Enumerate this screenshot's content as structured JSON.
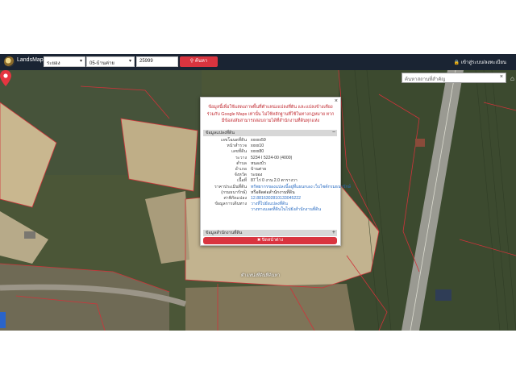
{
  "topbar": {
    "app_title": "LandsMaps",
    "province_select": "ระยอง",
    "district_select": "05-บ้านค่าย",
    "parcel_input": "25999",
    "search_button": "ค้นหา",
    "user_link": "เข้าสู่ระบบ/ลงทะเบียน"
  },
  "map": {
    "search_placeholder": "ค้นหาสถานที่สำคัญ",
    "pin_label": "ตำแหน่งที่ดินที่ค้นหา"
  },
  "popup": {
    "warning": "ข้อมูลนี้เพื่อใช้แสดงภาพพื้นที่ตำแหน่งแปลงที่ดิน และแปลงข้างเคียงร่วมกับ Google Maps เท่านั้น ไม่ใช้หลักฐานที่ใช้ในทางกฎหมาย หากมีข้อสงสัยสามารถสอบถามได้ที่สำนักงานที่ดินทุกแห่ง",
    "section_land": "ข้อมูลแปลงที่ดิน",
    "section_land_toggle": "−",
    "rows": [
      {
        "label": "เลขโฉนดที่ดิน",
        "value": "xxxxx59"
      },
      {
        "label": "หน้าสำรวจ",
        "value": "xxxx10"
      },
      {
        "label": "เลขที่ดิน",
        "value": "xxxx80"
      },
      {
        "label": "ระวาง",
        "value": "5234 I 5224-00 (4000)"
      },
      {
        "label": "ตำบล",
        "value": "หนองบัว"
      },
      {
        "label": "อำเภอ",
        "value": "บ้านค่าย"
      },
      {
        "label": "จังหวัด",
        "value": "ระยอง"
      },
      {
        "label": "เนื้อที่",
        "value": "87 ไร่ 0 งาน 2.0 ตารางวา"
      },
      {
        "label": "ราคาประเมินที่ดิน",
        "value": "ทรัพยากรของแปลงนี้อยู่ที่แผนกเอง เว็บไซต์กรมธนารักษ์"
      },
      {
        "label": "(กรมธนารักษ์)",
        "value": "หรือติดต่อสำนักงานที่ดิน"
      },
      {
        "label": "ค่าพิกัดแปลง",
        "value": "12.8816302810133045222"
      },
      {
        "label": "ข้อมูลการเดินทาง",
        "value": "วางที่ไปยังแปลงที่ดิน"
      },
      {
        "label": "",
        "value": "วางทางแลดที่ดินในไปยังสำนักงานที่ดิน"
      }
    ],
    "section_office": "ข้อมูลสำนักงานที่ดิน",
    "section_office_toggle": "+",
    "back_button": "✖ ปิดหน้าต่าง",
    "close_icon": "×"
  }
}
